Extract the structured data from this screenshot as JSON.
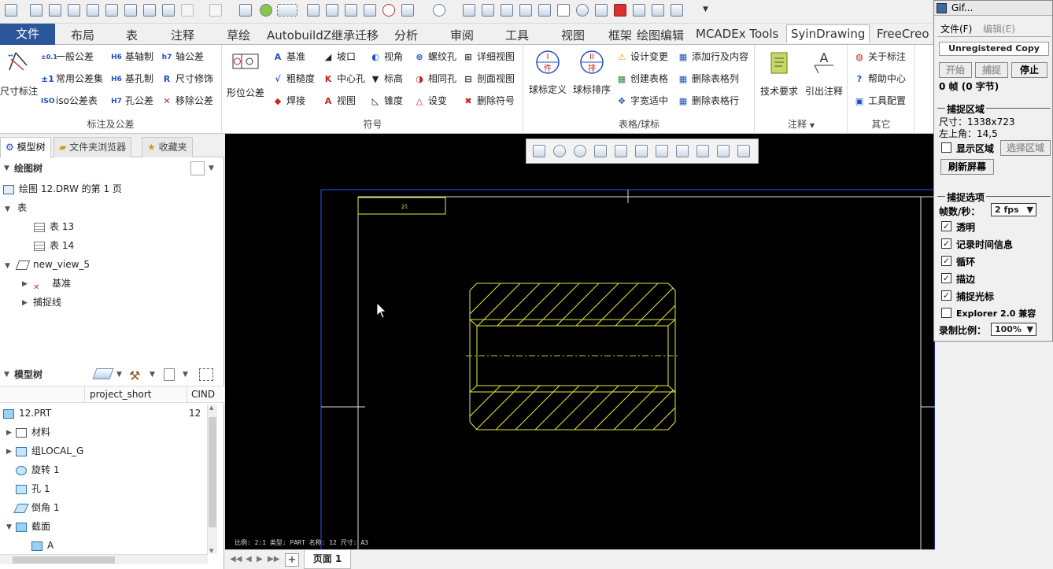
{
  "ribbon_tabs": {
    "file": "文件",
    "layout": "布局",
    "table": "表",
    "annotate": "注释",
    "sketch": "草绘",
    "migrate": "AutobuildZ继承迁移",
    "analysis": "分析",
    "review": "审阅",
    "tools": "工具",
    "view": "视图",
    "frame": "框架",
    "drawing_edit": "绘图编辑",
    "mcadex": "MCADEx Tools",
    "syin": "SyinDrawing",
    "freecreo": "FreeCreo"
  },
  "ribbon": {
    "dim_group": {
      "label": "标注及公差",
      "size_dim": "尺寸标注",
      "general_tol": "一般公差",
      "common_tol": "常用公差集",
      "iso_tol": "iso公差表",
      "shaft_base": "基轴制",
      "hole_base": "基孔制",
      "hole_tol": "孔公差",
      "shaft_tol": "轴公差",
      "dim_modify": "尺寸修饰",
      "remove_tol": "移除公差"
    },
    "symbol_group": {
      "label": "符号",
      "form_tol": "形位公差",
      "datum": "基准",
      "roughness": "粗糙度",
      "weld": "焊接",
      "slope": "坡口",
      "center_hole": "中心孔",
      "view": "视图",
      "view_angle": "视角",
      "elevation": "标高",
      "taper": "锥度",
      "thread_hole": "螺纹孔",
      "same_hole": "相同孔",
      "set_change": "设变",
      "detail_view": "详细视图",
      "section_view": "剖面视图",
      "delete_symbol": "删除符号"
    },
    "table_group": {
      "label": "表格/球标",
      "balloon_def": "球标定义",
      "balloon_sort": "球标排序",
      "balloon_def_icon": "件",
      "balloon_sort_icon": "排",
      "design_change": "设计变更",
      "create_table": "创建表格",
      "char_fit": "字宽适中",
      "add_row_col": "添加行及内容",
      "delete_col": "删除表格列",
      "delete_row": "删除表格行"
    },
    "note_group": {
      "label": "注释",
      "tech_req": "技术要求",
      "leader_note": "引出注释",
      "leader_icon": "A"
    },
    "other_group": {
      "label": "其它",
      "about": "关于标注",
      "help": "帮助中心",
      "tool_cfg": "工具配置"
    }
  },
  "panel_tabs": {
    "model_tree": "模型树",
    "file_browser": "文件夹浏览器",
    "favorites": "收藏夹"
  },
  "drawing_tree": {
    "header": "绘图树",
    "items": [
      {
        "label": "绘图 12.DRW 的第 1 页"
      },
      {
        "label": "表"
      },
      {
        "label": "表 13"
      },
      {
        "label": "表 14"
      },
      {
        "label": "new_view_5"
      },
      {
        "label": "基准"
      },
      {
        "label": "捕捉线"
      }
    ]
  },
  "model_tree": {
    "header": "模型树",
    "col_name": "project_short",
    "col_cind": "CIND",
    "items": [
      {
        "label": "12.PRT",
        "value": "12"
      },
      {
        "label": "材料"
      },
      {
        "label": "组LOCAL_G"
      },
      {
        "label": "旋转 1"
      },
      {
        "label": "孔 1"
      },
      {
        "label": "倒角 1"
      },
      {
        "label": "截面"
      },
      {
        "label": "A"
      }
    ]
  },
  "drawing": {
    "title_cell": "2l",
    "status_line": "比例: 2:1      类型: PART    名称: 12    尺寸: A3"
  },
  "page_tab": "页面 1",
  "gif_window": {
    "title": "Gif...",
    "menu_file": "文件(F)",
    "menu_edit": "编辑(E)",
    "banner": "Unregistered Copy",
    "btn_start": "开始",
    "btn_capture": "捕捉",
    "btn_stop": "停止",
    "frames": "0 帧 (0 字节)",
    "capture_region": "捕捉区域",
    "size": "尺寸：1338x723",
    "top_left": "左上角：14,5",
    "show_region": "显示区域",
    "select_region": "选择区域",
    "refresh": "刷新屏幕",
    "capture_options": "捕捉选项",
    "fps_label": "帧数/秒：",
    "fps_value": "2 fps",
    "opt_transparent": "透明",
    "opt_timing": "记录时间信息",
    "opt_loop": "循环",
    "opt_border": "描边",
    "opt_cursor": "捕捉光标",
    "opt_explorer": "Explorer 2.0 兼容",
    "scale_label": "录制比例：",
    "scale_value": "100%"
  },
  "colors": {
    "accent": "#2b579a",
    "drawing_line": "#e8e840",
    "frame_blue": "#3050ff",
    "centerline": "#c0c040"
  }
}
